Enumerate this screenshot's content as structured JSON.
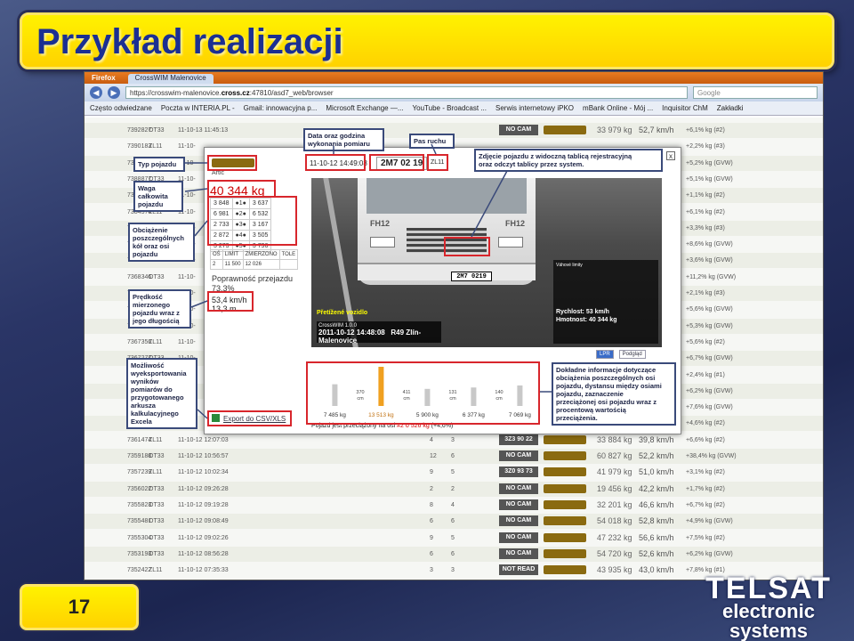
{
  "slide": {
    "title": "Przykład realizacji",
    "page_number": "17",
    "logo_line1": "TELSAT",
    "logo_line2": "electronic",
    "logo_line3": "systems"
  },
  "browser": {
    "menu_label": "Firefox",
    "tab_title": "CrossWIM Malenovice",
    "url_prefix": "https://crosswim-malenovice.",
    "url_host": "cross.cz",
    "url_suffix": ":47810/asd7_web/browser",
    "search_placeholder": "Google",
    "bookmarks": [
      "Często odwiedzane",
      "Poczta w INTERIA.PL -",
      "Gmail: innowacyjna p...",
      "Microsoft Exchange —...",
      "YouTube - Broadcast ...",
      "Serwis internetowy iPKO",
      "mBank Online - Mój ...",
      "Inquisitor ChM",
      "Zakładki"
    ]
  },
  "table_rows": [
    {
      "id": "7392827",
      "lane": "OT33",
      "dt": "11-10-13 11:45:13",
      "a": "",
      "b": "",
      "plate": "NO CAM",
      "weight": "33 979 kg",
      "speed": "52,7 km/h",
      "ov": "+6,1% kg (#2)"
    },
    {
      "id": "7390183",
      "lane": "ZL11",
      "dt": "11-10-",
      "a": "",
      "b": "",
      "plate": "",
      "weight": "",
      "speed": "",
      "ov": "+2,2% kg (#3)"
    },
    {
      "id": "7390022",
      "lane": "OT33",
      "dt": "11-10-",
      "a": "",
      "b": "",
      "plate": "",
      "weight": "",
      "speed": "",
      "ov": "+5,2% kg (GVW)"
    },
    {
      "id": "7388877",
      "lane": "OT33",
      "dt": "11-10-",
      "a": "",
      "b": "",
      "plate": "",
      "weight": "",
      "speed": "",
      "ov": "+5,1% kg (GVW)"
    },
    {
      "id": "7386948",
      "lane": "ZL11",
      "dt": "11-10-",
      "a": "",
      "b": "",
      "plate": "",
      "weight": "",
      "speed": "",
      "ov": "+1,1% kg (#2)"
    },
    {
      "id": "7384574",
      "lane": "ZL11",
      "dt": "11-10-",
      "a": "",
      "b": "",
      "plate": "",
      "weight": "",
      "speed": "",
      "ov": "+6,1% kg (#2)"
    },
    {
      "id": "7382265",
      "lane": "OT33",
      "dt": "11-10-",
      "a": "",
      "b": "",
      "plate": "",
      "weight": "",
      "speed": "",
      "ov": "+3,3% kg (#3)"
    },
    {
      "id": "7377218",
      "lane": "ZL11",
      "dt": "11-10-",
      "a": "",
      "b": "",
      "plate": "",
      "weight": "",
      "speed": "",
      "ov": "+8,6% kg (GVW)"
    },
    {
      "id": "7375682",
      "lane": "OT33",
      "dt": "11-10-",
      "a": "",
      "b": "",
      "plate": "",
      "weight": "",
      "speed": "",
      "ov": "+3,6% kg (GVW)"
    },
    {
      "id": "7368346",
      "lane": "OT33",
      "dt": "11-10-",
      "a": "",
      "b": "",
      "plate": "",
      "weight": "",
      "speed": "",
      "ov": "+11,2% kg (GVW)"
    },
    {
      "id": "7367951",
      "lane": "ZL11",
      "dt": "11-10-",
      "a": "",
      "b": "",
      "plate": "",
      "weight": "",
      "speed": "",
      "ov": "+2,1% kg (#3)"
    },
    {
      "id": "7367753",
      "lane": "ZL11",
      "dt": "11-10-",
      "a": "",
      "b": "",
      "plate": "",
      "weight": "",
      "speed": "",
      "ov": "+5,6% kg (GVW)"
    },
    {
      "id": "7367578",
      "lane": "OT33",
      "dt": "11-10-",
      "a": "",
      "b": "",
      "plate": "",
      "weight": "",
      "speed": "",
      "ov": "+5,3% kg (GVW)"
    },
    {
      "id": "7367356",
      "lane": "ZL11",
      "dt": "11-10-",
      "a": "",
      "b": "",
      "plate": "",
      "weight": "",
      "speed": "",
      "ov": "+5,6% kg (#2)"
    },
    {
      "id": "7367277",
      "lane": "OT33",
      "dt": "11-10-",
      "a": "",
      "b": "",
      "plate": "",
      "weight": "",
      "speed": "",
      "ov": "+6,7% kg (GVW)"
    },
    {
      "id": "7364170",
      "lane": "ZL11",
      "dt": "11-10-",
      "a": "",
      "b": "",
      "plate": "",
      "weight": "",
      "speed": "",
      "ov": "+2,4% kg (#1)"
    },
    {
      "id": "7363990",
      "lane": "OT33",
      "dt": "11-10-",
      "a": "",
      "b": "",
      "plate": "",
      "weight": "",
      "speed": "",
      "ov": "+6,2% kg (GVW)"
    },
    {
      "id": "7363612",
      "lane": "OT33",
      "dt": "11-10-",
      "a": "",
      "b": "",
      "plate": "",
      "weight": "",
      "speed": "",
      "ov": "+7,6% kg (GVW)"
    },
    {
      "id": "7363253",
      "lane": "ZL11",
      "dt": "11-10-",
      "a": "",
      "b": "",
      "plate": "",
      "weight": "",
      "speed": "",
      "ov": "+4,6% kg (#2)"
    },
    {
      "id": "7361474",
      "lane": "ZL11",
      "dt": "11-10-12 12:07:03",
      "a": "4",
      "b": "3",
      "plate": "3Z3 90 22",
      "weight": "33 884 kg",
      "speed": "39,8 km/h",
      "ov": "+6,6% kg (#2)"
    },
    {
      "id": "7359188",
      "lane": "OT33",
      "dt": "11-10-12 10:56:57",
      "a": "12",
      "b": "6",
      "plate": "NO CAM",
      "weight": "60 827 kg",
      "speed": "52,2 km/h",
      "ov": "+38,4% kg (GVW)"
    },
    {
      "id": "7357239",
      "lane": "ZL11",
      "dt": "11-10-12 10:02:34",
      "a": "9",
      "b": "5",
      "plate": "3Z0 93 73",
      "weight": "41 979 kg",
      "speed": "51,0 km/h",
      "ov": "+3,1% kg (#2)"
    },
    {
      "id": "7356022",
      "lane": "OT33",
      "dt": "11-10-12 09:26:28",
      "a": "2",
      "b": "2",
      "plate": "NO CAM",
      "weight": "19 456 kg",
      "speed": "42,2 km/h",
      "ov": "+1,7% kg (#2)"
    },
    {
      "id": "7355823",
      "lane": "OT33",
      "dt": "11-10-12 09:19:28",
      "a": "8",
      "b": "4",
      "plate": "NO CAM",
      "weight": "32 201 kg",
      "speed": "46,6 km/h",
      "ov": "+6,7% kg (#2)"
    },
    {
      "id": "7355481",
      "lane": "OT33",
      "dt": "11-10-12 09:08:49",
      "a": "6",
      "b": "6",
      "plate": "NO CAM",
      "weight": "54 018 kg",
      "speed": "52,8 km/h",
      "ov": "+4,9% kg (GVW)"
    },
    {
      "id": "7355304",
      "lane": "OT33",
      "dt": "11-10-12 09:02:26",
      "a": "9",
      "b": "5",
      "plate": "NO CAM",
      "weight": "47 232 kg",
      "speed": "56,6 km/h",
      "ov": "+7,5% kg (#2)"
    },
    {
      "id": "7353193",
      "lane": "OT33",
      "dt": "11-10-12 08:56:28",
      "a": "6",
      "b": "6",
      "plate": "NO CAM",
      "weight": "54 720 kg",
      "speed": "52,6 km/h",
      "ov": "+6,2% kg (GVW)"
    },
    {
      "id": "7352422",
      "lane": "ZL11",
      "dt": "11-10-12 07:35:33",
      "a": "3",
      "b": "3",
      "plate": "NOT READ",
      "weight": "43 935 kg",
      "speed": "43,0 km/h",
      "ov": "+7,8% kg (#1)"
    }
  ],
  "modal": {
    "vehicle_type": "Artic",
    "total_weight": "40 344 kg",
    "axles": [
      {
        "w": "3 848",
        "n": "●1●",
        "d": "3 637"
      },
      {
        "w": "6 981",
        "n": "●2●",
        "d": "6 532"
      },
      {
        "w": "2 733",
        "n": "●3●",
        "d": "3 167"
      },
      {
        "w": "2 872",
        "n": "●4●",
        "d": "3 505"
      },
      {
        "w": "3 273",
        "n": "●5●",
        "d": "3 796"
      }
    ],
    "limit_headers": [
      "OŚ",
      "LIMIT",
      "ZMIERZONO",
      "TOLE"
    ],
    "limit_row": [
      "2",
      "11 500",
      "12 026",
      ""
    ],
    "accuracy_label": "Poprawność przejazdu",
    "accuracy_value": "73,3%",
    "speed_value": "53,4 km/h",
    "length_value": "13,3 m",
    "export_label": "Export do CSV/XLS",
    "measure_datetime": "11-10-12 14:49:08",
    "plate_read": "2M7 02 19",
    "lane_code": "ZL11",
    "close_label": "x",
    "photo_overload": "Přetížené vozidlo",
    "photo_system": "CrossWIM 1.0.0",
    "photo_dt": "2011-10-12 14:48:08",
    "photo_location": "R49 Zlín-Malenovice",
    "photo_plate": "2M7 0219",
    "photo_brand_left": "FH12",
    "photo_brand_right": "FH12",
    "photo_limits_title": "Váhové limity",
    "photo_speed_label": "Rychlost:",
    "photo_speed": "53 km/h",
    "photo_weight_label": "Hmotnost:",
    "photo_weight": "40 344 kg",
    "photo_tab_lpr": "LPR",
    "photo_tab_view": "Podgląd",
    "overload_note_prefix": "Pojazd jest przeciążony na osi",
    "overload_note_value": "#2 o 526 kg",
    "overload_note_suffix": "(+4,6%)"
  },
  "chart_data": {
    "type": "bar",
    "categories": [
      "1",
      "2",
      "3",
      "4",
      "5"
    ],
    "values": [
      7485,
      13513,
      5900,
      6377,
      7069
    ],
    "value_labels": [
      "7 485 kg",
      "13 513 kg",
      "5 900 kg",
      "6 377 kg",
      "7 069 kg"
    ],
    "gap_labels": [
      "370\ncm",
      "411\ncm",
      "131\ncm",
      "140\ncm"
    ],
    "highlight_index": 1,
    "colors": {
      "normal": "#c8c8c8",
      "highlight": "#f0a020"
    }
  },
  "callouts": {
    "typ": "Typ pojazdu",
    "waga": "Waga\ncałkowita\npojazdu",
    "obciazenie": "Obciążenie\nposzczególnych\nkół oraz osi\npojazdu",
    "predkosc": "Prędkość\nmierzonego\npojazdu wraz z\njego długością",
    "eksport": "Możliwość\nwyeksportowania\nwyników\npomiarów do\nprzygotowanego\narkusza\nkalkulacyjnego\nExcela",
    "data": "Data oraz godzina\nwykonania pomiaru",
    "pas": "Pas ruchu",
    "zdjecie": "Zdjęcie pojazdu z widoczną tablicą rejestracyjną\noraz odczyt tablicy przez system.",
    "dokladne": "Dokładne informacje dotyczące\nobciążenia poszczególnych osi\npojazdu, dystansu między osiami\npojazdu, zaznaczenie\nprzeciążonej osi pojazdu wraz z\nprocentową wartością\nprzeciążenia."
  }
}
